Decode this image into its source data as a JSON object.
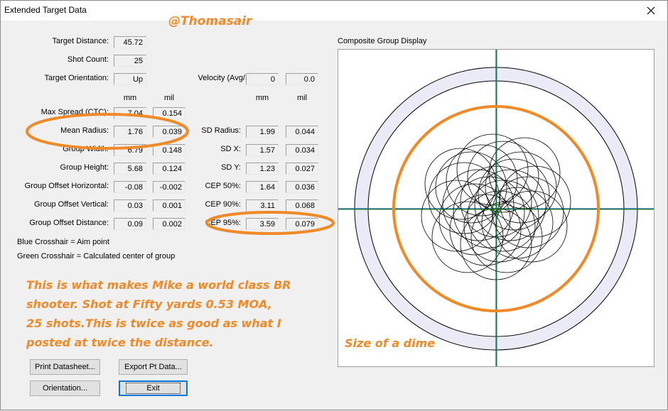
{
  "window": {
    "title": "Extended Target Data"
  },
  "watermark": "@Thomasair",
  "fields": {
    "target_distance": {
      "label": "Target Distance:",
      "value": "45.72"
    },
    "shot_count": {
      "label": "Shot Count:",
      "value": "25"
    },
    "target_orientation": {
      "label": "Target Orientation:",
      "value": "Up"
    },
    "velocity": {
      "label": "Velocity (Avg/SD):",
      "avg": "0",
      "sd": "0.0"
    }
  },
  "column_headers": {
    "mm": "mm",
    "mil": "mil"
  },
  "left_stats": [
    {
      "label": "Max Spread (CTC):",
      "mm": "7.04",
      "mil": "0.154"
    },
    {
      "label": "Mean Radius:",
      "mm": "1.76",
      "mil": "0.039"
    },
    {
      "label": "Group Width:",
      "mm": "6.79",
      "mil": "0.148"
    },
    {
      "label": "Group Height:",
      "mm": "5.68",
      "mil": "0.124"
    },
    {
      "label": "Group Offset Horizontal:",
      "mm": "-0.08",
      "mil": "-0.002"
    },
    {
      "label": "Group Offset Vertical:",
      "mm": "0.03",
      "mil": "0.001"
    },
    {
      "label": "Group Offset Distance:",
      "mm": "0.09",
      "mil": "0.002"
    }
  ],
  "right_stats": [
    {
      "label": "SD Radius:",
      "mm": "1.99",
      "mil": "0.044"
    },
    {
      "label": "SD X:",
      "mm": "1.57",
      "mil": "0.034"
    },
    {
      "label": "SD Y:",
      "mm": "1.23",
      "mil": "0.027"
    },
    {
      "label": "CEP 50%:",
      "mm": "1.64",
      "mil": "0.036"
    },
    {
      "label": "CEP 90%:",
      "mm": "3.11",
      "mil": "0.068"
    },
    {
      "label": "CEP 95%:",
      "mm": "3.59",
      "mil": "0.079"
    }
  ],
  "legend": {
    "blue": "Blue Crosshair = Aim point",
    "green": "Green Crosshair = Calculated center of group"
  },
  "annotation": {
    "lines": [
      "This is what makes Mike a world class BR",
      "shooter.  Shot at Fifty yards 0.53 MOA,",
      "25 shots.This is twice as good as what I",
      "posted at twice the distance."
    ],
    "dime": "Size of a dime"
  },
  "display": {
    "title": "Composite Group Display"
  },
  "buttons": {
    "print": "Print Datasheet...",
    "export": "Export Pt Data...",
    "orientation": "Orientation...",
    "exit": "Exit"
  },
  "colors": {
    "annotation": "#f08a28",
    "ring": "#ebebf8",
    "green_crosshair": "#1d8a1d",
    "blue_crosshair": "#1a5a9a"
  }
}
